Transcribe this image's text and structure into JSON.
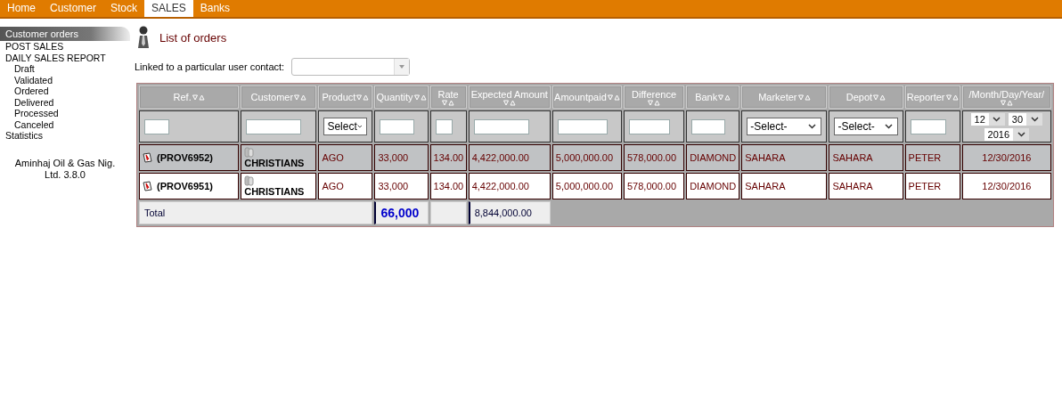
{
  "nav": [
    {
      "label": "Home",
      "selected": false
    },
    {
      "label": "Customer",
      "selected": false
    },
    {
      "label": "Stock",
      "selected": false
    },
    {
      "label": "SALES",
      "selected": true
    },
    {
      "label": "Banks",
      "selected": false
    }
  ],
  "sidebar": {
    "title": "Customer orders",
    "items": [
      {
        "label": "POST SALES"
      },
      {
        "label": "DAILY SALES REPORT",
        "children": [
          {
            "label": "Draft"
          },
          {
            "label": "Validated"
          },
          {
            "label": "Ordered"
          },
          {
            "label": "Delivered"
          },
          {
            "label": "Processed"
          },
          {
            "label": "Canceled"
          }
        ]
      },
      {
        "label": "Statistics"
      }
    ],
    "footer": "Aminhaj Oil & Gas Nig. Ltd. 3.8.0"
  },
  "page_title": "List of orders",
  "contact_filter": {
    "label": "Linked to a particular user contact:"
  },
  "table": {
    "columns": [
      "Ref.",
      "Customer",
      "Product",
      "Quantity",
      "Rate",
      "Expected Amount",
      "Amountpaid",
      "Difference",
      "Bank",
      "Marketer",
      "Depot",
      "Reporter",
      "/Month/Day/Year/"
    ],
    "filters": [
      {
        "kind": "input"
      },
      {
        "kind": "input"
      },
      {
        "kind": "select",
        "value": "Select"
      },
      {
        "kind": "input"
      },
      {
        "kind": "input"
      },
      {
        "kind": "input"
      },
      {
        "kind": "input"
      },
      {
        "kind": "input"
      },
      {
        "kind": "input"
      },
      {
        "kind": "select",
        "value": "-Select-"
      },
      {
        "kind": "select",
        "value": "-Select-"
      },
      {
        "kind": "input"
      },
      {
        "kind": "date",
        "month": "12",
        "day": "30",
        "year": "2016"
      }
    ],
    "rows": [
      {
        "selected": true,
        "cells": [
          "(PROV6952)",
          "CHRISTIANS",
          "AGO",
          "33,000",
          "134.00",
          "4,422,000.00",
          "5,000,000.00",
          "578,000.00",
          "DIAMOND",
          "SAHARA",
          "SAHARA",
          "PETER",
          "12/30/2016"
        ]
      },
      {
        "selected": false,
        "cells": [
          "(PROV6951)",
          "CHRISTIANS",
          "AGO",
          "33,000",
          "134.00",
          "4,422,000.00",
          "5,000,000.00",
          "578,000.00",
          "DIAMOND",
          "SAHARA",
          "SAHARA",
          "PETER",
          "12/30/2016"
        ]
      }
    ],
    "total": {
      "label": "Total",
      "quantity": "66,000",
      "expected_amount": "8,844,000.00"
    }
  }
}
